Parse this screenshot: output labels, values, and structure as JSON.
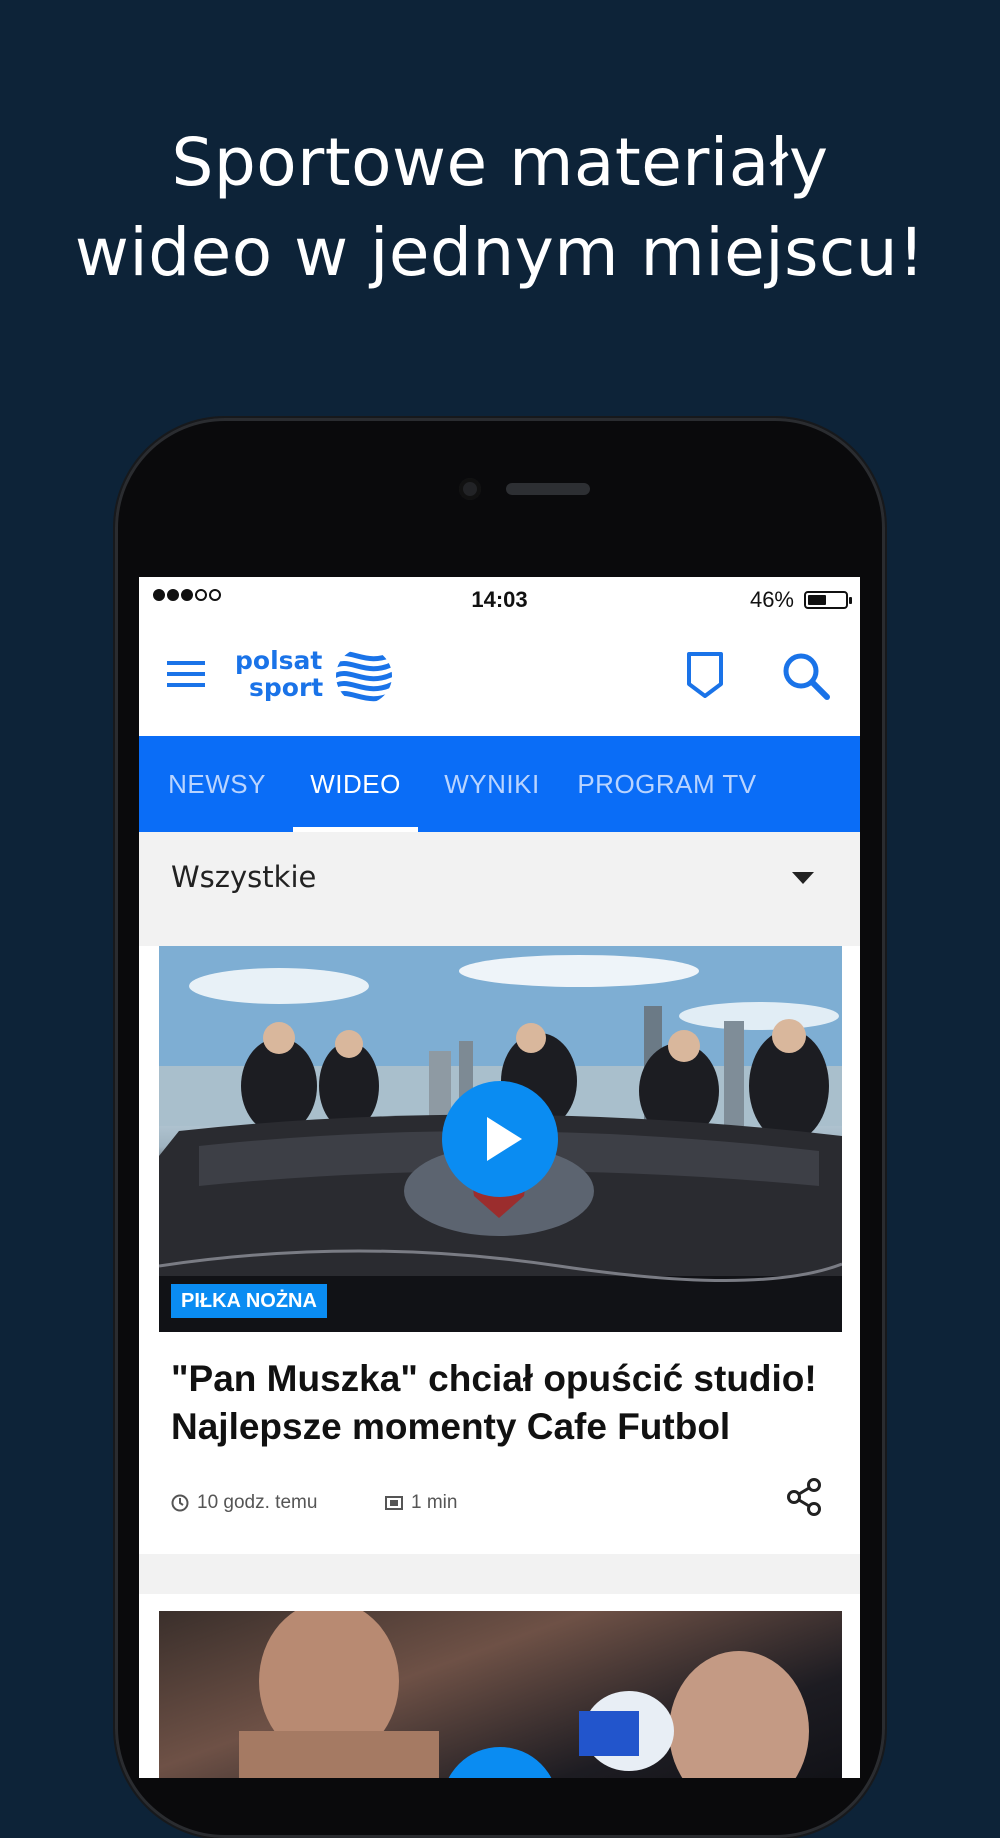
{
  "promo": {
    "headline_line1": "Sportowe materiały",
    "headline_line2": "wideo w jednym miejscu!"
  },
  "status_bar": {
    "time": "14:03",
    "battery": "46%",
    "signal_filled": 3,
    "signal_total": 5,
    "battery_level": 0.46
  },
  "app_bar": {
    "logo_line1": "polsat",
    "logo_line2": "sport",
    "brand_color": "#1a73e8"
  },
  "tabs": [
    {
      "label": "NEWSY",
      "active": false
    },
    {
      "label": "WIDEO",
      "active": true
    },
    {
      "label": "WYNIKI",
      "active": false
    },
    {
      "label": "PROGRAM TV",
      "active": false
    }
  ],
  "filter": {
    "selected": "Wszystkie"
  },
  "feed": {
    "items": [
      {
        "category": "PIŁKA NOŻNA",
        "title": "\"Pan Muszka\" chciał opuścić studio! Najlepsze momenty Cafe Futbol",
        "age": "10 godz. temu",
        "duration": "1 min"
      }
    ]
  },
  "colors": {
    "background": "#0d2338",
    "tab_bar": "#0a6df7",
    "accent": "#0a8cf2"
  }
}
